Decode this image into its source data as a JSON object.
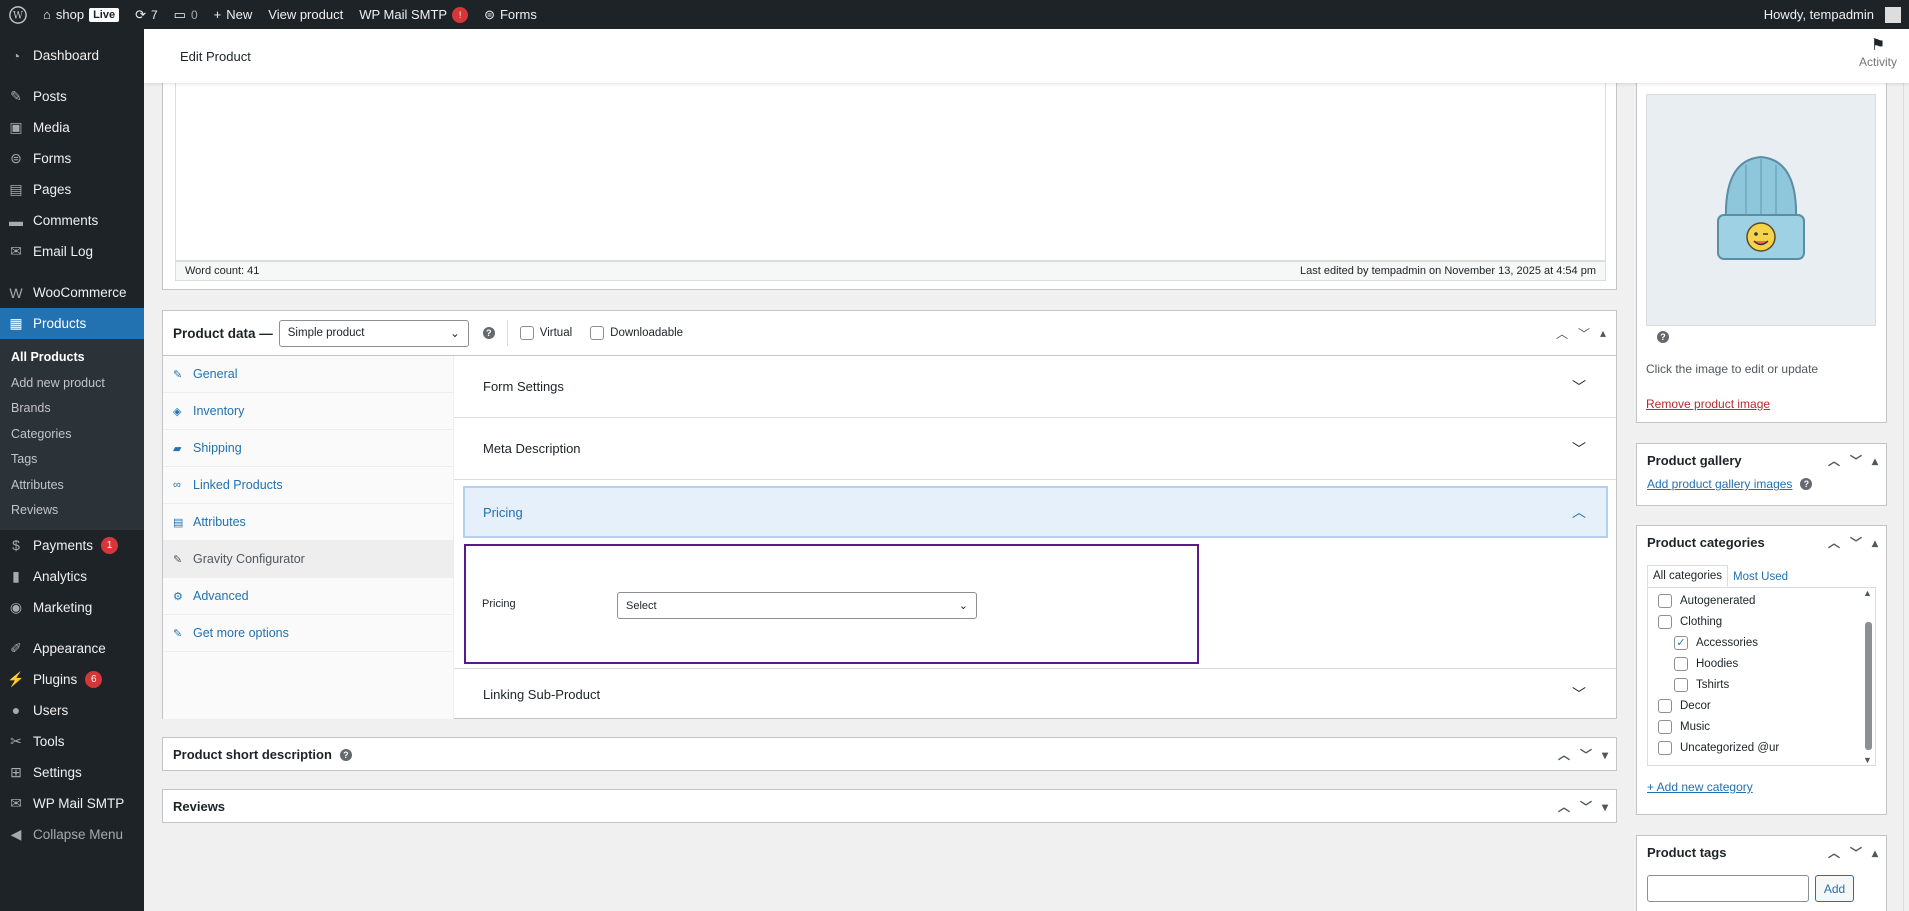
{
  "adminbar": {
    "site_name": "shop",
    "live_label": "Live",
    "updates_count": "7",
    "comments_count": "0",
    "new_label": "New",
    "view_product_label": "View product",
    "wp_mail_smtp_label": "WP Mail SMTP",
    "wp_mail_smtp_badge": "!",
    "forms_label": "Forms",
    "howdy": "Howdy, tempadmin"
  },
  "sidebar": {
    "items": [
      {
        "label": "Dashboard",
        "icon": "dashboard-icon"
      },
      {
        "label": "Posts",
        "icon": "pin-icon"
      },
      {
        "label": "Media",
        "icon": "media-icon"
      },
      {
        "label": "Forms",
        "icon": "forms-icon"
      },
      {
        "label": "Pages",
        "icon": "pages-icon"
      },
      {
        "label": "Comments",
        "icon": "comment-icon"
      },
      {
        "label": "Email Log",
        "icon": "email-icon"
      },
      {
        "label": "WooCommerce",
        "icon": "woo-icon"
      },
      {
        "label": "Products",
        "icon": "products-icon"
      },
      {
        "label": "Payments",
        "icon": "payments-icon",
        "badge": "1"
      },
      {
        "label": "Analytics",
        "icon": "analytics-icon"
      },
      {
        "label": "Marketing",
        "icon": "marketing-icon"
      },
      {
        "label": "Appearance",
        "icon": "brush-icon"
      },
      {
        "label": "Plugins",
        "icon": "plugin-icon",
        "badge": "6"
      },
      {
        "label": "Users",
        "icon": "user-icon"
      },
      {
        "label": "Tools",
        "icon": "wrench-icon"
      },
      {
        "label": "Settings",
        "icon": "settings-icon"
      },
      {
        "label": "WP Mail SMTP",
        "icon": "mail-icon"
      },
      {
        "label": "Collapse Menu",
        "icon": "collapse-icon"
      }
    ],
    "submenu": [
      "All Products",
      "Add new product",
      "Brands",
      "Categories",
      "Tags",
      "Attributes",
      "Reviews"
    ]
  },
  "header": {
    "title": "Edit Product",
    "activity_label": "Activity"
  },
  "editor": {
    "word_count": "Word count: 41",
    "last_edited": "Last edited by tempadmin on November 13, 2025 at 4:54 pm"
  },
  "product_data": {
    "title": "Product data —",
    "type_value": "Simple product",
    "virtual_label": "Virtual",
    "downloadable_label": "Downloadable",
    "tabs": [
      "General",
      "Inventory",
      "Shipping",
      "Linked Products",
      "Attributes",
      "Gravity Configurator",
      "Advanced",
      "Get more options"
    ],
    "accordions": [
      "Form Settings",
      "Meta Description",
      "Pricing",
      "Linking Sub-Product"
    ],
    "pricing_field_label": "Pricing",
    "pricing_select_value": "Select"
  },
  "short_description": {
    "title": "Product short description"
  },
  "reviews": {
    "title": "Reviews"
  },
  "product_image": {
    "hint": "Click the image to edit or update",
    "remove_label": "Remove product image"
  },
  "gallery": {
    "title": "Product gallery",
    "add_label": "Add product gallery images"
  },
  "categories": {
    "title": "Product categories",
    "tab_all": "All categories",
    "tab_most_used": "Most Used",
    "items": [
      {
        "label": "Autogenerated",
        "checked": false,
        "indent": 0
      },
      {
        "label": "Clothing",
        "checked": false,
        "indent": 0
      },
      {
        "label": "Accessories",
        "checked": true,
        "indent": 1
      },
      {
        "label": "Hoodies",
        "checked": false,
        "indent": 1
      },
      {
        "label": "Tshirts",
        "checked": false,
        "indent": 1
      },
      {
        "label": "Decor",
        "checked": false,
        "indent": 0
      },
      {
        "label": "Music",
        "checked": false,
        "indent": 0
      },
      {
        "label": "Uncategorized @ur",
        "checked": false,
        "indent": 0
      }
    ],
    "add_new_label": "+ Add new category"
  },
  "tags": {
    "title": "Product tags",
    "add_button": "Add"
  }
}
